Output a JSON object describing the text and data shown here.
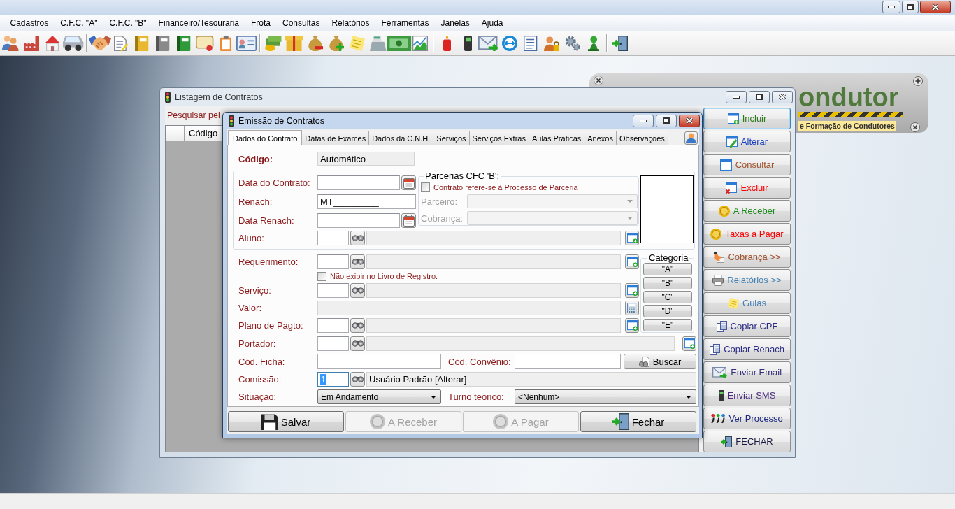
{
  "app": {
    "menu": [
      "Cadastros",
      "C.F.C. \"A\"",
      "C.F.C. \"B\"",
      "Financeiro/Tesouraria",
      "Frota",
      "Consultas",
      "Relatórios",
      "Ferramentas",
      "Janelas",
      "Ajuda"
    ]
  },
  "logo_panel": {
    "title": "ondutor",
    "subtitle": "e Formação de Condutores"
  },
  "list_window": {
    "title": "Listagem de Contratos",
    "active": false,
    "search_label": "Pesquisar pel",
    "table": {
      "columns": [
        "Código"
      ]
    },
    "actions": [
      {
        "label": "Incluir",
        "color": "#2b7a1c",
        "focused": true
      },
      {
        "label": "Alterar",
        "color": "#1c3fc0",
        "focused": false
      },
      {
        "label": "Consultar",
        "color": "#a0522d",
        "focused": false
      },
      {
        "label": "Excluir",
        "color": "#ff0000",
        "focused": false
      },
      {
        "label": "A Receber",
        "color": "#1e8a1e",
        "focused": false
      },
      {
        "label": "Taxas a Pagar",
        "color": "#ff0000",
        "focused": false
      },
      {
        "label": "Cobrança >>",
        "color": "#a0522d",
        "focused": false
      },
      {
        "label": "Relatórios >>",
        "color": "#4682b4",
        "focused": false
      },
      {
        "label": "Guias",
        "color": "#4682b4",
        "focused": false
      },
      {
        "label": "Copiar CPF",
        "color": "#2b2b85",
        "focused": false
      },
      {
        "label": "Copiar Renach",
        "color": "#2b2b85",
        "focused": false
      },
      {
        "label": "Enviar Email",
        "color": "#35307a",
        "focused": false
      },
      {
        "label": "Enviar SMS",
        "color": "#4a2c80",
        "focused": false
      },
      {
        "label": "Ver Processo",
        "color": "#202a80",
        "focused": false
      },
      {
        "label": "FECHAR",
        "color": "#1a1a40",
        "focused": false
      }
    ]
  },
  "dialog": {
    "title": "Emissão de Contratos",
    "active": true,
    "tabs": [
      {
        "label": "Dados do Contrato",
        "selected": true
      },
      {
        "label": "Datas de Exames",
        "selected": false
      },
      {
        "label": "Dados da C.N.H.",
        "selected": false
      },
      {
        "label": "Serviços",
        "selected": false
      },
      {
        "label": "Serviços Extras",
        "selected": false
      },
      {
        "label": "Aulas Práticas",
        "selected": false
      },
      {
        "label": "Anexos",
        "selected": false
      },
      {
        "label": "Observações",
        "selected": false
      }
    ],
    "codigo": {
      "label": "Código:",
      "value": "Automático"
    },
    "data_contrato": {
      "label": "Data do Contrato:"
    },
    "renach": {
      "label": "Renach:",
      "value": "MT_________"
    },
    "data_renach": {
      "label": "Data Renach:"
    },
    "aluno": {
      "label": "Aluno:"
    },
    "parcerias": {
      "title": "Parcerias CFC 'B':",
      "checkbox": {
        "label": "Contrato refere-se à Processo de Parceria",
        "checked": false
      },
      "fields": [
        {
          "label": "Parceiro:",
          "disabled": true
        },
        {
          "label": "Cobrança:",
          "disabled": true
        }
      ]
    },
    "requerimento": {
      "label": "Requerimento:"
    },
    "registro_checkbox": {
      "label": "Não exibir no Livro de Registro.",
      "checked": false
    },
    "servico": {
      "label": "Serviço:"
    },
    "valor": {
      "label": "Valor:"
    },
    "plano_pagto": {
      "label": "Plano de Pagto:"
    },
    "portador": {
      "label": "Portador:"
    },
    "cod_ficha": {
      "label": "Cód. Ficha:"
    },
    "cod_convenio": {
      "label": "Cód. Convênio:"
    },
    "search_button": "Buscar",
    "comissao": {
      "label": "Comissão:",
      "value": "1",
      "value_selected": true,
      "description": "Usuário Padrão [Alterar]"
    },
    "situacao": {
      "label": "Situação:",
      "value": "Em Andamento"
    },
    "turno_teorico": {
      "label": "Turno teórico:",
      "value": "<Nenhum>"
    },
    "categoria": {
      "title": "Categoria",
      "options": [
        "\"A\"",
        "\"B\"",
        "\"C\"",
        "\"D\"",
        "\"E\""
      ]
    },
    "buttons": [
      {
        "label": "Salvar",
        "disabled": false
      },
      {
        "label": "A Receber",
        "disabled": true
      },
      {
        "label": "A Pagar",
        "disabled": true
      },
      {
        "label": "Fechar",
        "disabled": false
      }
    ]
  }
}
